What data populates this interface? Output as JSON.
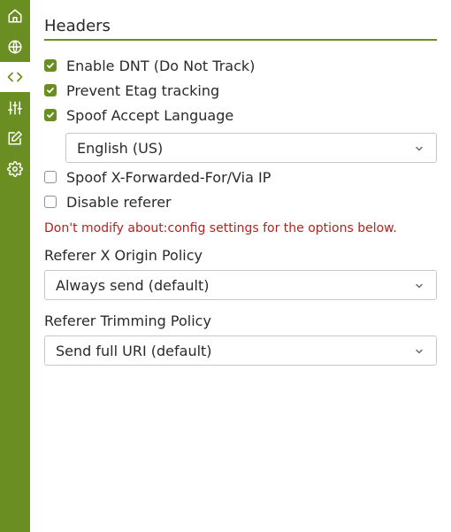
{
  "colors": {
    "accent": "#6b8e23",
    "warning": "#b22222",
    "text": "#2a2a2a"
  },
  "sidebar": {
    "items": [
      {
        "icon": "home-icon",
        "active": false
      },
      {
        "icon": "globe-icon",
        "active": false
      },
      {
        "icon": "code-icon",
        "active": true
      },
      {
        "icon": "sliders-icon",
        "active": false
      },
      {
        "icon": "edit-icon",
        "active": false
      },
      {
        "icon": "gear-icon",
        "active": false
      }
    ]
  },
  "headers": {
    "title": "Headers",
    "options": {
      "enable_dnt": {
        "label": "Enable DNT (Do Not Track)",
        "checked": true
      },
      "prevent_etag": {
        "label": "Prevent Etag tracking",
        "checked": true
      },
      "spoof_accept_language": {
        "label": "Spoof Accept Language",
        "checked": true
      },
      "spoof_x_forwarded": {
        "label": "Spoof X-Forwarded-For/Via IP",
        "checked": false
      },
      "disable_referer": {
        "label": "Disable referer",
        "checked": false
      }
    },
    "language_select": {
      "value": "English (US)"
    },
    "warning": "Don't modify about:config settings for the options below.",
    "referer_x_origin": {
      "label": "Referer X Origin Policy",
      "value": "Always send (default)"
    },
    "referer_trimming": {
      "label": "Referer Trimming Policy",
      "value": "Send full URI (default)"
    }
  }
}
